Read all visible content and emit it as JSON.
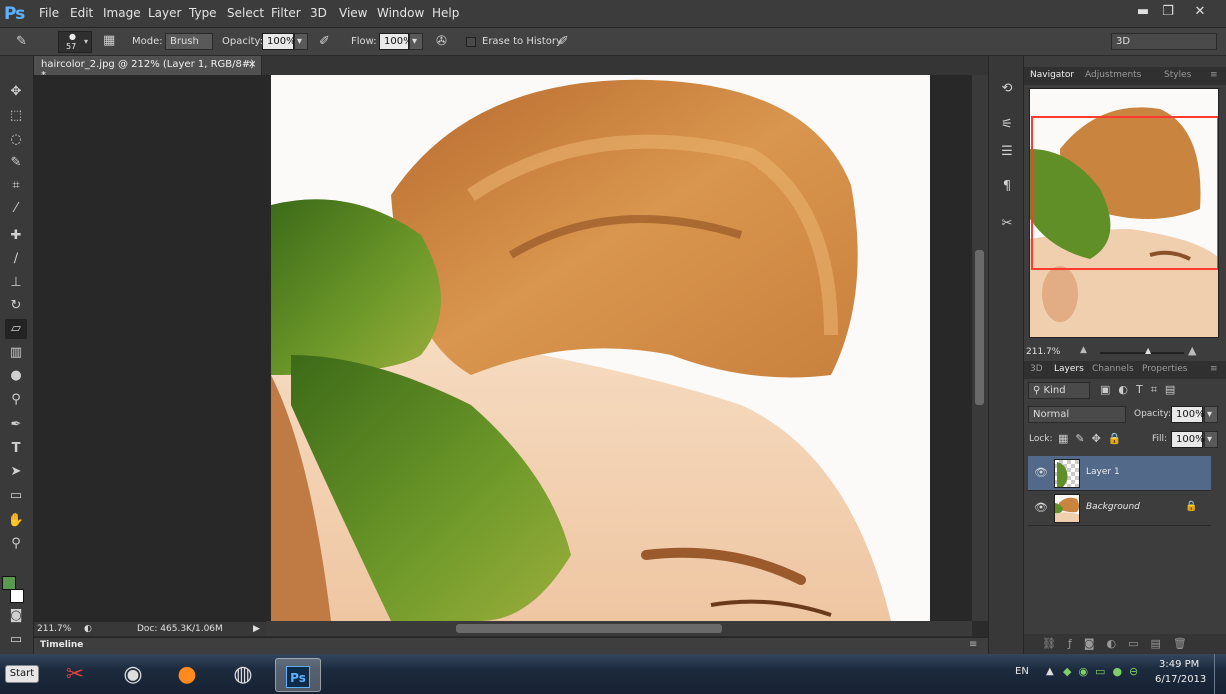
{
  "menubar": {
    "logo": "Ps",
    "items": [
      "File",
      "Edit",
      "Image",
      "Layer",
      "Type",
      "Select",
      "Filter",
      "3D",
      "View",
      "Window",
      "Help"
    ],
    "window_buttons": [
      "▬",
      "❐",
      "✕"
    ]
  },
  "options_bar": {
    "brush_size": "57",
    "mode_label": "Mode:",
    "mode_value": "Brush",
    "opacity_label": "Opacity:",
    "opacity_value": "100%",
    "flow_label": "Flow:",
    "flow_value": "100%",
    "erase_to_history_label": "Erase to History",
    "workspace_value": "3D"
  },
  "document": {
    "tab_title": "haircolor_2.jpg @ 212% (Layer 1, RGB/8#) *",
    "zoom": "211.7%",
    "doc_info": "Doc: 465.3K/1.06M"
  },
  "timeline": {
    "label": "Timeline"
  },
  "navigator": {
    "tabs": [
      "Navigator",
      "Adjustments",
      "Styles"
    ],
    "zoom": "211.7%"
  },
  "layers_panel": {
    "tabs": [
      "3D",
      "Layers",
      "Channels",
      "Properties"
    ],
    "filter_kind": "Kind",
    "blend_mode": "Normal",
    "opacity_label": "Opacity:",
    "opacity_value": "100%",
    "lock_label": "Lock:",
    "fill_label": "Fill:",
    "fill_value": "100%",
    "layers": [
      {
        "name": "Layer 1",
        "selected": true
      },
      {
        "name": "Background",
        "selected": false,
        "locked": true
      }
    ]
  },
  "taskbar": {
    "start_label": "Start",
    "language": "EN",
    "time": "3:49 PM",
    "date": "6/17/2013"
  },
  "colors": {
    "foreground": "#5a9a4e",
    "background": "#ffffff",
    "accent": "#52698a"
  }
}
